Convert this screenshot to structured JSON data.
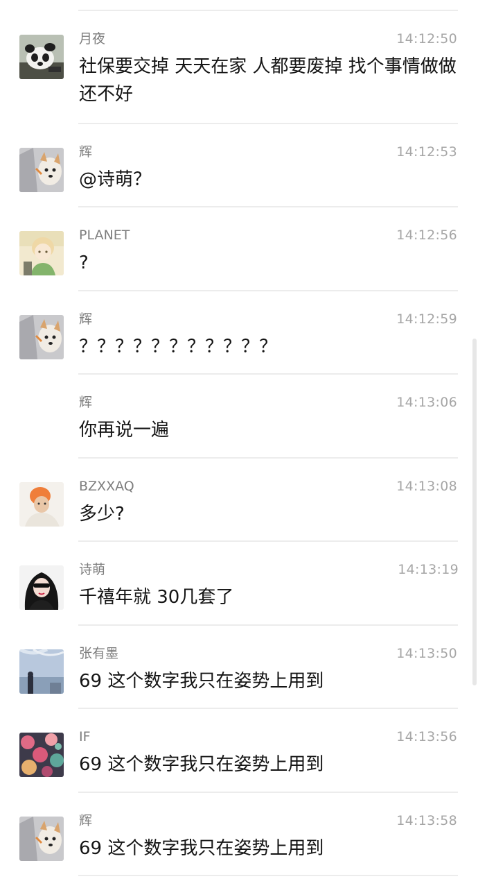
{
  "messages": [
    {
      "name": "月夜",
      "time": "14:12:50",
      "text": "社保要交掉 天天在家 人都要废掉 找个事情做做还不好",
      "avatar": "panda-avatar"
    },
    {
      "name": "辉",
      "time": "14:12:53",
      "text": "@诗萌？",
      "avatar": "dog-avatar"
    },
    {
      "name": "PLANET",
      "time": "14:12:56",
      "text": "?",
      "avatar": "anime-boy-avatar"
    },
    {
      "name": "辉",
      "time": "14:12:59",
      "text": "？？？？？？？？？？？",
      "avatar": "dog-avatar"
    },
    {
      "name": "辉",
      "time": "14:13:06",
      "text": "你再说一遍",
      "avatar": "none"
    },
    {
      "name": "BZXXAQ",
      "time": "14:13:08",
      "text": "多少?",
      "avatar": "orange-hair-avatar"
    },
    {
      "name": "诗萌",
      "time": "14:13:19",
      "text": "千禧年就 30几套了",
      "avatar": "girl-sunglasses-avatar"
    },
    {
      "name": "张有墨",
      "time": "14:13:50",
      "text": "69 这个数字我只在姿势上用到",
      "avatar": "blue-sky-avatar"
    },
    {
      "name": "IF",
      "time": "14:13:56",
      "text": "69 这个数字我只在姿势上用到",
      "avatar": "flowers-avatar"
    },
    {
      "name": "辉",
      "time": "14:13:58",
      "text": "69 这个数字我只在姿势上用到",
      "avatar": "dog-avatar"
    }
  ]
}
